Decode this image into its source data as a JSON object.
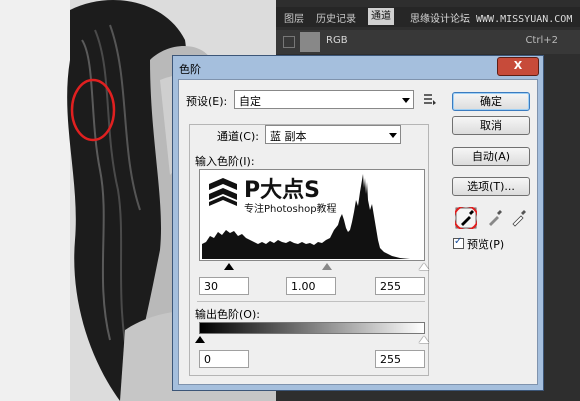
{
  "panel": {
    "tabs": [
      "图层",
      "历史记录",
      "通道"
    ],
    "watermark": "思缘设计论坛 WWW.MISSYUAN.COM",
    "channel_row": {
      "name": "RGB",
      "shortcut": "Ctrl+2"
    }
  },
  "dialog": {
    "title": "色阶",
    "close_label": "X",
    "preset_label": "预设(E):",
    "preset_value": "自定",
    "channel_label": "通道(C):",
    "channel_value": "蓝 副本",
    "input_levels_label": "输入色阶(I):",
    "output_levels_label": "输出色阶(O):",
    "input_values": {
      "black": "30",
      "gamma": "1.00",
      "white": "255"
    },
    "output_values": {
      "black": "0",
      "white": "255"
    },
    "buttons": {
      "ok": "确定",
      "cancel": "取消",
      "auto": "自动(A)",
      "options": "选项(T)..."
    },
    "preview_label": "预览(P)",
    "preview_checked": true,
    "logo": {
      "title": "P大点S",
      "subtitle": "专注Photoshop教程"
    }
  },
  "colors": {
    "highlight_circle": "#e02020",
    "dialog_frame": "#a5bfdd"
  },
  "icons": [
    "preset-options-icon",
    "black-eyedropper-icon",
    "gray-eyedropper-icon",
    "white-eyedropper-icon",
    "channel-visibility-icon"
  ]
}
